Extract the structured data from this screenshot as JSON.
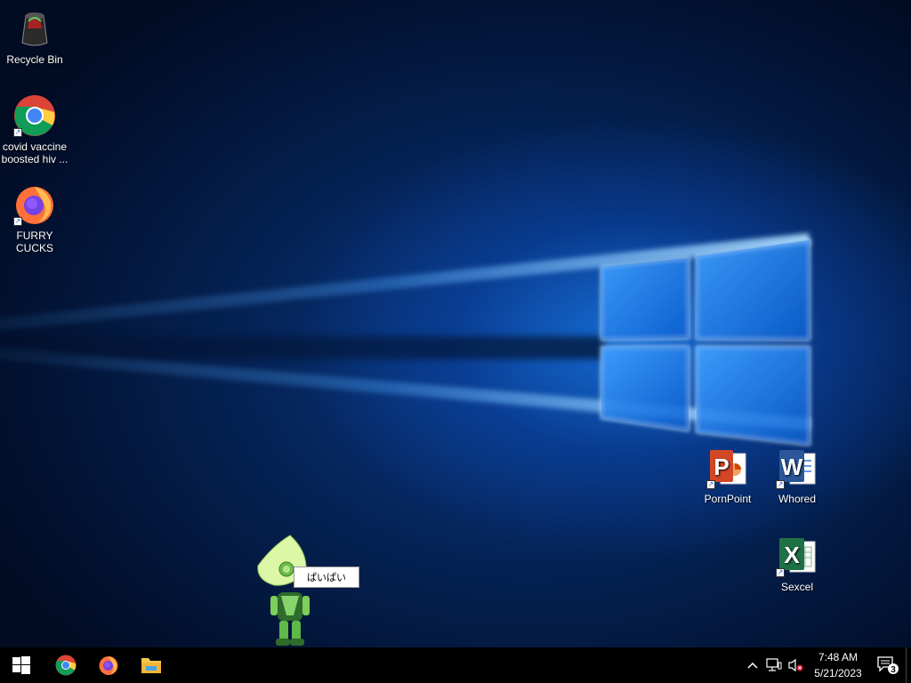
{
  "desktop": {
    "icons": [
      {
        "label": "Recycle Bin",
        "icon": "recycle-bin-icon"
      },
      {
        "label": "covid vaccine boosted hiv ...",
        "icon": "chrome-icon"
      },
      {
        "label": "FURRY CUCKS",
        "icon": "firefox-icon"
      },
      {
        "label": "PornPoint",
        "icon": "powerpoint-icon"
      },
      {
        "label": "Whored",
        "icon": "word-icon"
      },
      {
        "label": "Sexcel",
        "icon": "excel-icon"
      }
    ],
    "pet": {
      "speech": "ぱいぱい"
    }
  },
  "taskbar": {
    "pinned": [
      {
        "name": "start-button",
        "icon": "windows-icon"
      },
      {
        "name": "chrome-taskbar",
        "icon": "chrome-icon"
      },
      {
        "name": "firefox-taskbar",
        "icon": "firefox-icon"
      },
      {
        "name": "file-explorer-taskbar",
        "icon": "folder-icon"
      }
    ],
    "clock": {
      "time": "7:48 AM",
      "date": "5/21/2023"
    },
    "notifications": {
      "count": "3"
    }
  },
  "colors": {
    "accent": "#0078d7",
    "taskbar": "#000000",
    "wallpaper_dark": "#021333"
  }
}
